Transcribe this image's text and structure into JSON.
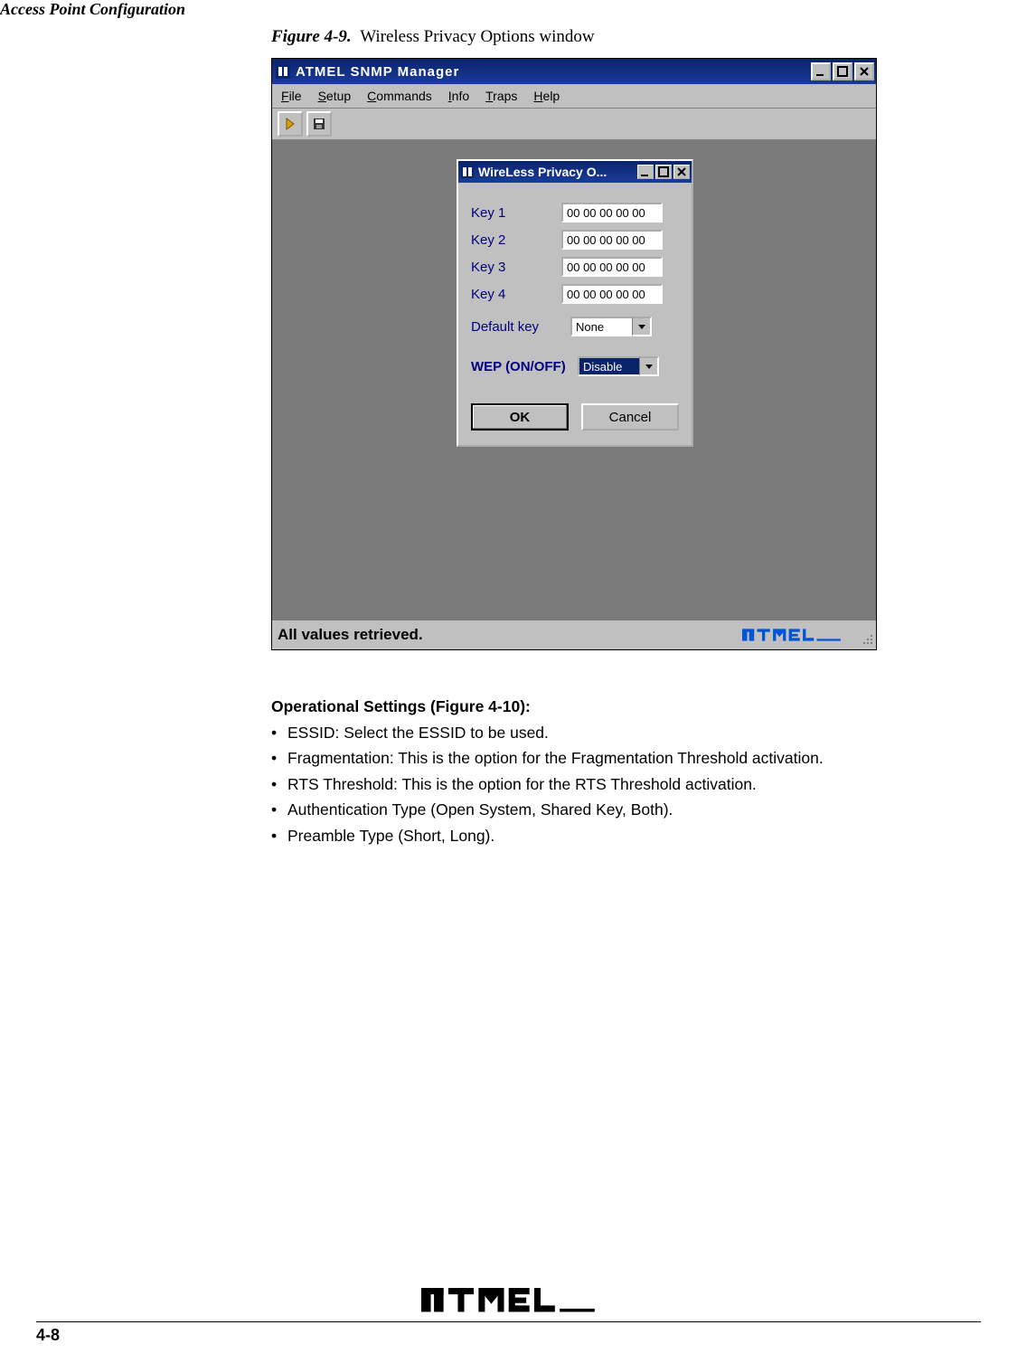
{
  "running_head": "Access Point Configuration",
  "figure": {
    "label": "Figure 4-9.",
    "caption": "Wireless Privacy Options window"
  },
  "app_window": {
    "title": "ATMEL SNMP Manager",
    "menu": {
      "file": {
        "label": "File",
        "underline_index": 0
      },
      "setup": {
        "label": "Setup",
        "underline_index": 0
      },
      "commands": {
        "label": "Commands",
        "underline_index": 0
      },
      "info": {
        "label": "Info",
        "underline_index": 0
      },
      "traps": {
        "label": "Traps",
        "underline_index": 0
      },
      "help": {
        "label": "Help",
        "underline_index": 0
      }
    },
    "toolbar": {
      "btn1_name": "connect-icon",
      "btn2_name": "save-icon"
    },
    "status_text": "All values retrieved.",
    "brand_text": "ATMEL"
  },
  "dialog": {
    "title": "WireLess Privacy O...",
    "keys": {
      "key1_label": "Key 1",
      "key1_value": "00 00 00 00 00",
      "key2_label": "Key 2",
      "key2_value": "00 00 00 00 00",
      "key3_label": "Key 3",
      "key3_value": "00 00 00 00 00",
      "key4_label": "Key 4",
      "key4_value": "00 00 00 00 00"
    },
    "default_key_label": "Default key",
    "default_key_value": "None",
    "wep_label": "WEP (ON/OFF)",
    "wep_value": "Disable",
    "ok_label": "OK",
    "cancel_label": "Cancel"
  },
  "section": {
    "heading": "Operational Settings (Figure 4-10):",
    "items": [
      "ESSID: Select the ESSID to be used.",
      "Fragmentation: This is the option for the Fragmentation Threshold activation.",
      "RTS Threshold: This is the option for the RTS Threshold activation.",
      "Authentication Type (Open System, Shared Key, Both).",
      "Preamble Type (Short, Long)."
    ]
  },
  "footer": {
    "page_number": "4-8",
    "brand": "ATMEL"
  }
}
